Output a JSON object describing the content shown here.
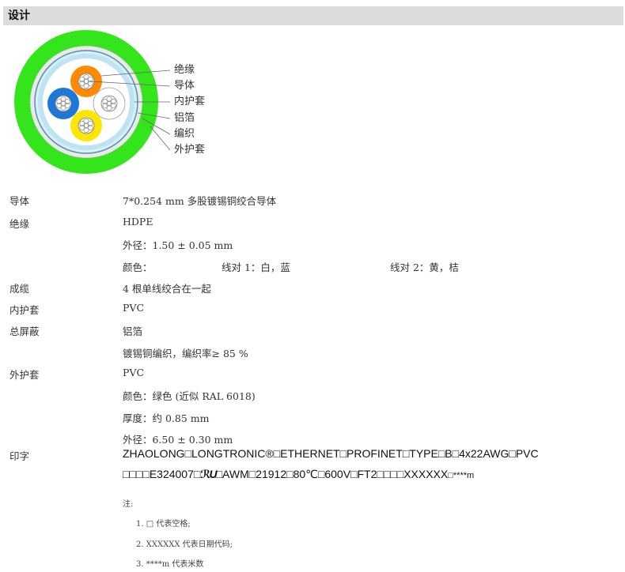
{
  "section_title": "设计",
  "diagram": {
    "callouts": [
      "绝缘",
      "导体",
      "内护套",
      "铝箔",
      "编织",
      "外护套"
    ],
    "colors": {
      "outer_jacket": "#33e51a",
      "braid": "#e8ece8",
      "inner_jacket": "#bfe3f2",
      "core_orange": "#ff8a00",
      "core_blue": "#1e78d8",
      "core_white": "#ffffff",
      "core_yellow": "#ffe600"
    }
  },
  "specs": [
    {
      "label": "导体",
      "value": "7*0.254 mm 多股镀锡铜绞合导体"
    },
    {
      "label": "绝缘",
      "value": "HDPE"
    },
    {
      "label": "",
      "value": "外径：1.50 ± 0.05 mm"
    },
    {
      "label": "",
      "value": "颜色：",
      "pair1": "线对 1：白，蓝",
      "pair2": "线对 2：黄，桔"
    },
    {
      "label": "成缆",
      "value": "4 根单线绞合在一起"
    },
    {
      "label": "内护套",
      "value": "PVC"
    },
    {
      "label": "总屏蔽",
      "value": "铝箔"
    },
    {
      "label": "",
      "value": "镀锡铜编织，编织率≥ 85 %"
    },
    {
      "label": "外护套",
      "value": "PVC"
    },
    {
      "label": "",
      "value": "颜色：绿色 (近似 RAL 6018)"
    },
    {
      "label": "",
      "value": "厚度：约 0.85 mm"
    },
    {
      "label": "",
      "value": "外径：6.50 ± 0.30 mm"
    }
  ],
  "printing": {
    "label": "印字",
    "line1": "ZHAOLONG□LONGTRONIC®□ETHERNET□PROFINET□TYPE□B□4x22AWG□PVC",
    "line2a": "□□□□E324007□",
    "ul_mark": "ℛU",
    "line2b": "□AWM□21912□80℃□600V□FT2□□□□XXXXXX",
    "line2c": "□****m"
  },
  "notes": {
    "title": "注:",
    "items": [
      "1. □ 代表空格;",
      "2. XXXXXX 代表日期代码;",
      "3. ****m 代表米数"
    ]
  }
}
